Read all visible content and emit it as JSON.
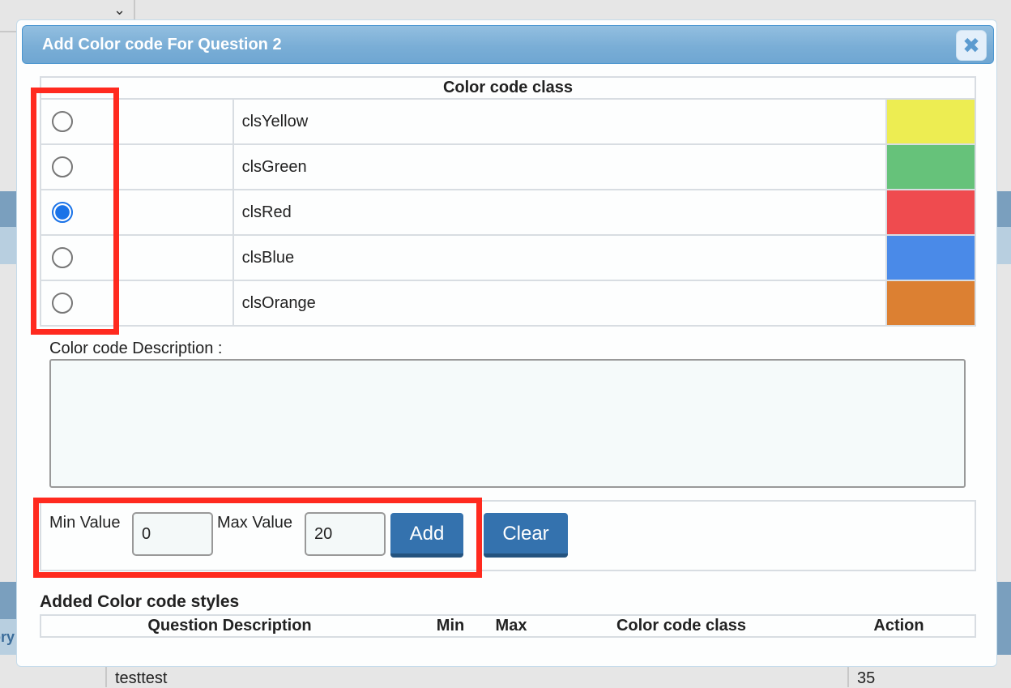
{
  "background": {
    "bottom_row": {
      "name": "testtest",
      "value": "35"
    },
    "partial_text": "ory"
  },
  "dialog": {
    "title": "Add Color code For Question 2",
    "close_icon": "close-x-icon",
    "color_table": {
      "header": "Color code class",
      "rows": [
        {
          "name": "clsYellow",
          "color": "#eded52",
          "selected": false
        },
        {
          "name": "clsGreen",
          "color": "#66c27a",
          "selected": false
        },
        {
          "name": "clsRed",
          "color": "#ef4b4f",
          "selected": true
        },
        {
          "name": "clsBlue",
          "color": "#4a8ae8",
          "selected": false
        },
        {
          "name": "clsOrange",
          "color": "#dc8032",
          "selected": false
        }
      ]
    },
    "description_label": "Color code Description :",
    "description_value": "",
    "min_label": "Min Value",
    "min_value": "0",
    "max_label": "Max Value",
    "max_value": "20",
    "add_label": "Add",
    "clear_label": "Clear",
    "added_title": "Added Color code styles",
    "added_columns": [
      "Question Description",
      "Min",
      "Max",
      "Color code class",
      "Action"
    ],
    "highlight_color": "#ff2a1f"
  }
}
